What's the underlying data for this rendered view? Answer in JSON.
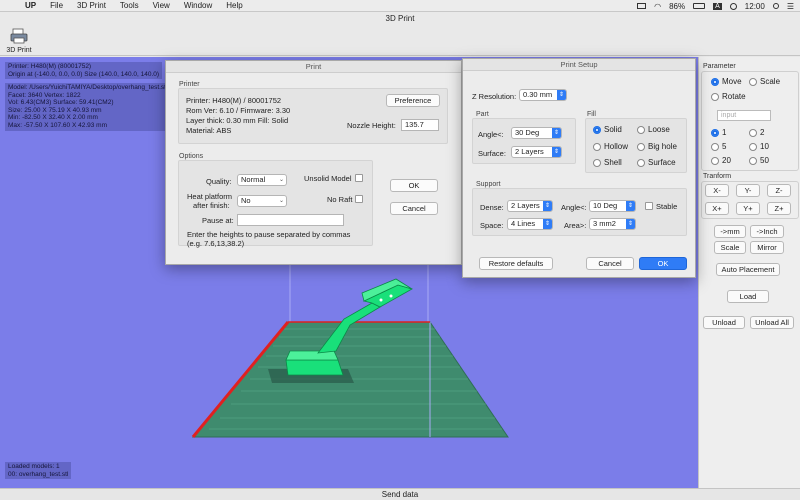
{
  "menubar": {
    "app": "UP",
    "items": [
      "File",
      "3D Print",
      "Tools",
      "View",
      "Window",
      "Help"
    ],
    "battery": "86%",
    "input_source": "A",
    "clock": "12:00"
  },
  "window": {
    "title": "3D Print"
  },
  "toolbar": {
    "print_label": "3D Print"
  },
  "info": {
    "printer_line": "Printer: H480(M) (80001752)",
    "origin_line": "Origin at (-140.0, 0.0, 0.0)   Size (140.0, 140.0, 140.0)",
    "model_line": "Model: /Users/YuichiTAMIYA/Desktop/overhang_test.stl",
    "facet_line": "Facet: 3640    Vertex: 1822",
    "vol_line": "Vol: 6.43(CM3)    Surface: 59.41(CM2)",
    "size_line": "Size: 25.00 X 75.19 X 40.93 mm",
    "min_line": "Min: -82.50 X 32.40 X   2.00 mm",
    "max_line": "Max: -57.50 X 107.60 X  42.93 mm",
    "loaded_line": "Loaded models: 1",
    "loaded_item": "00: overhang_test.stl"
  },
  "print_dialog": {
    "title": "Print",
    "printer_section": "Printer",
    "printer_name": "Printer: H480(M) / 80001752",
    "rom": "Rom Ver: 6.10 / Firmware: 3.30",
    "layer": "Layer thick: 0.30 mm  Fill: Solid",
    "material": "Material: ABS",
    "preference_label": "Preference",
    "nozzle_label": "Nozzle Height:",
    "nozzle_value": "135.7",
    "options_section": "Options",
    "quality_label": "Quality:",
    "quality_value": "Normal",
    "unsolid_label": "Unsolid Model",
    "heat_label_1": "Heat platform",
    "heat_label_2": "after finish:",
    "heat_value": "No",
    "noraft_label": "No Raft",
    "pause_label": "Pause at:",
    "pause_value": "",
    "hint_1": "Enter the heights to pause separated by commas",
    "hint_2": "(e.g. 7.6,13,38.2)",
    "ok_label": "OK",
    "cancel_label": "Cancel"
  },
  "setup_dialog": {
    "title": "Print Setup",
    "zres_label": "Z Resolution:",
    "zres_value": "0.30 mm",
    "part_section": "Part",
    "angle_label": "Angle<:",
    "angle_value": "30 Deg",
    "surface_label": "Surface:",
    "surface_value": "2 Layers",
    "fill_section": "Fill",
    "fill_options": [
      "Solid",
      "Loose",
      "Hollow",
      "Big hole",
      "Shell",
      "Surface"
    ],
    "support_section": "Support",
    "dense_label": "Dense:",
    "dense_value": "2 Layers",
    "s_angle_label": "Angle<:",
    "s_angle_value": "10 Deg",
    "stable_label": "Stable",
    "space_label": "Space:",
    "space_value": "4 Lines",
    "area_label": "Area>:",
    "area_value": "3 mm2",
    "restore_label": "Restore defaults",
    "cancel_label": "Cancel",
    "ok_label": "OK"
  },
  "panel": {
    "parameter_label": "Parameter",
    "move_label": "Move",
    "scale_label": "Scale",
    "rotate_label": "Rotate",
    "input_placeholder": "input",
    "values": [
      "1",
      "2",
      "5",
      "10",
      "20",
      "50"
    ],
    "tranform_label": "Tranform",
    "axis_buttons": [
      "X-",
      "Y-",
      "Z-",
      "X+",
      "Y+",
      "Z+"
    ],
    "to_mm": "->mm",
    "to_inch": "->Inch",
    "scale_btn": "Scale",
    "mirror_btn": "Mirror",
    "auto_place": "Auto Placement",
    "load": "Load",
    "unload": "Unload",
    "unload_all": "Unload All"
  },
  "status": {
    "send_data": "Send data"
  },
  "colors": {
    "viewport": "#7b7de9",
    "platform": "#3f8b6e",
    "model": "#19e07a",
    "accent": "#2f7cf6"
  }
}
